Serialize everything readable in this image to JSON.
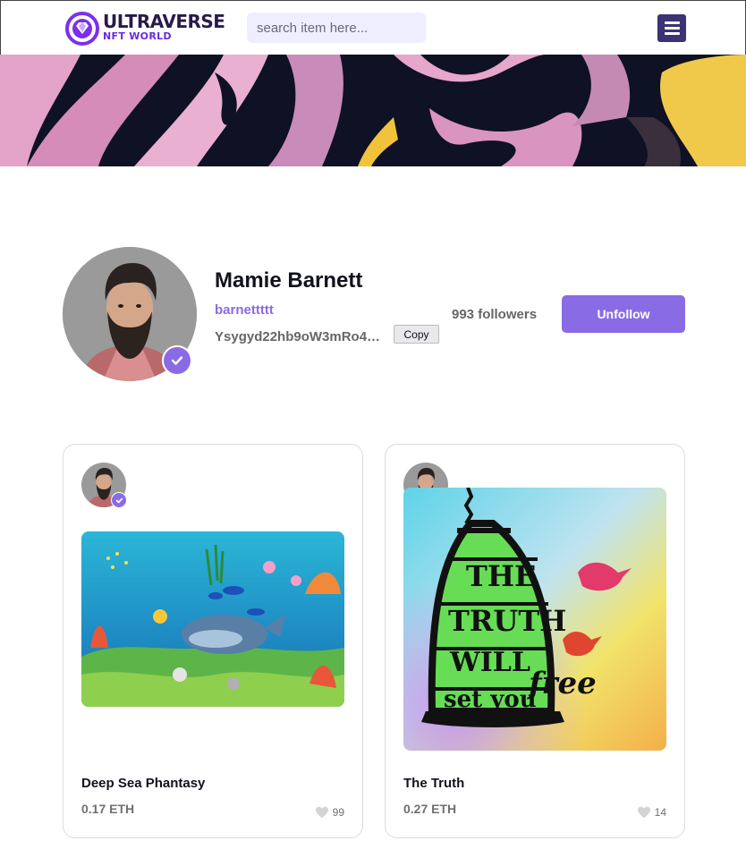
{
  "header": {
    "logo_title": "ULTRAVERSE",
    "logo_subtitle": "NFT WORLD",
    "search_placeholder": "search item here...",
    "menu_icon": "hamburger-icon"
  },
  "profile": {
    "name": "Mamie Barnett",
    "handle": "barnettttt",
    "wallet": "Ysygyd22hb9oW3mRo4k3a8ZB",
    "copy_label": "Copy",
    "followers": "993 followers",
    "follow_button": "Unfollow",
    "verified_icon": "check-badge-icon"
  },
  "items": [
    {
      "title": "Deep Sea Phantasy",
      "price": "0.17 ETH",
      "likes": "99",
      "like_icon": "heart-icon"
    },
    {
      "title": "The Truth",
      "price": "0.27 ETH",
      "likes": "14",
      "like_icon": "heart-icon"
    }
  ],
  "colors": {
    "accent": "#8a6be6",
    "menu_bg": "#3b3374",
    "search_bg": "#efeefe"
  }
}
